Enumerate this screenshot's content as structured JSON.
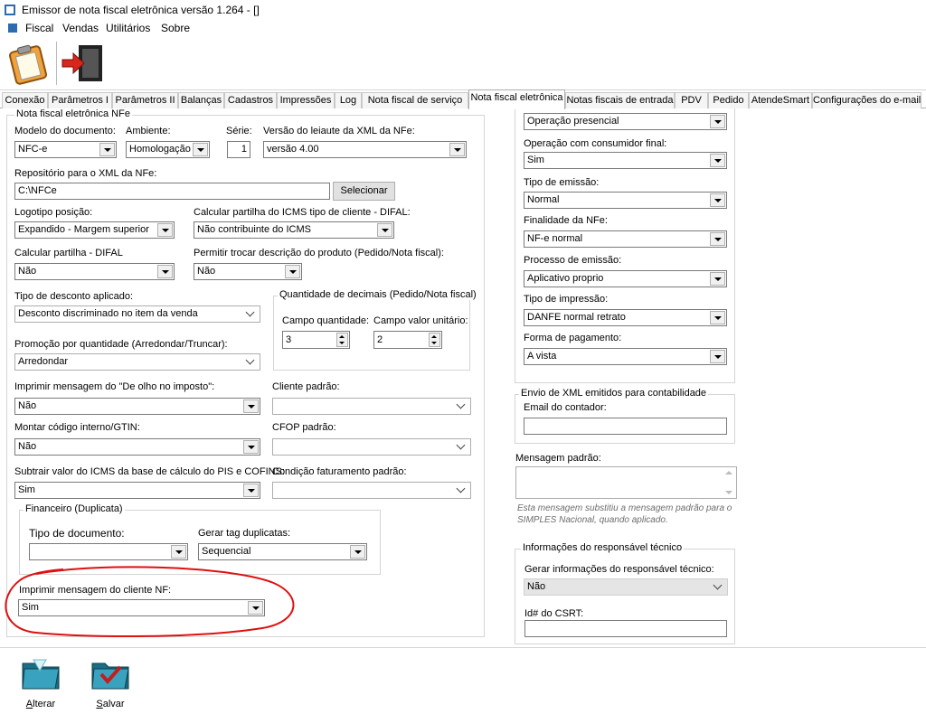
{
  "window": {
    "title": "Emissor de nota fiscal eletrônica versão 1.264 - []"
  },
  "menu": [
    "Fiscal",
    "Vendas",
    "Utilitários",
    "Sobre"
  ],
  "tabs": [
    "Conexão",
    "Parâmetros I",
    "Parâmetros II",
    "Balanças",
    "Cadastros",
    "Impressões",
    "Log",
    "Nota fiscal de serviço",
    "Nota fiscal eletrônica",
    "Notas fiscais de entrada",
    "PDV",
    "Pedido",
    "AtendeSmart",
    "Configurações do e-mail"
  ],
  "active_tab": "Nota fiscal eletrônica",
  "nfe": {
    "legend": "Nota fiscal eletrônica NFe",
    "modelo": {
      "label": "Modelo do documento:",
      "value": "NFC-e"
    },
    "ambiente": {
      "label": "Ambiente:",
      "value": "Homologação"
    },
    "serie": {
      "label": "Série:",
      "value": "1"
    },
    "versao": {
      "label": "Versão do leiaute da XML da NFe:",
      "value": "versão 4.00"
    },
    "repositorio": {
      "label": "Repositório para o XML da NFe:",
      "value": "C:\\NFCe",
      "button": "Selecionar"
    },
    "logotipo": {
      "label": "Logotipo posição:",
      "value": "Expandido - Margem superior"
    },
    "partilha_cliente": {
      "label": "Calcular partilha do ICMS tipo de cliente - DIFAL:",
      "value": "Não contribuinte do ICMS"
    },
    "partilha_difal": {
      "label": "Calcular partilha - DIFAL",
      "value": "Não"
    },
    "trocar_descricao": {
      "label": "Permitir trocar descrição do produto (Pedido/Nota fiscal):",
      "value": "Não"
    },
    "tipo_desconto": {
      "label": "Tipo de desconto aplicado:",
      "value": "Desconto discriminado no item da venda"
    },
    "decimais": {
      "legend": "Quantidade de decimais (Pedido/Nota fiscal)",
      "qtd_label": "Campo quantidade:",
      "qtd_value": "3",
      "valor_label": "Campo valor unitário:",
      "valor_value": "2"
    },
    "promocao": {
      "label": "Promoção por quantidade (Arredondar/Truncar):",
      "value": "Arredondar"
    },
    "olho_imposto": {
      "label": "Imprimir mensagem do \"De olho no imposto\":",
      "value": "Não"
    },
    "cliente_padrao": {
      "label": "Cliente padrão:",
      "value": ""
    },
    "codigo_interno": {
      "label": "Montar código interno/GTIN:",
      "value": "Não"
    },
    "cfop": {
      "label": "CFOP padrão:",
      "value": ""
    },
    "subtrair_icms": {
      "label": "Subtrair valor do ICMS da base de cálculo do PIS e COFINS:",
      "value": "Sim"
    },
    "condicao": {
      "label": "Condição faturamento padrão:",
      "value": ""
    },
    "financeiro": {
      "legend": "Financeiro (Duplicata)",
      "tipo_label": "Tipo de documento:",
      "tipo_value": "",
      "tag_label": "Gerar tag duplicatas:",
      "tag_value": "Sequencial"
    },
    "msg_cliente": {
      "label": "Imprimir mensagem do cliente NF:",
      "value": "Sim"
    }
  },
  "right": {
    "presenca": {
      "value": "Operação presencial"
    },
    "consumidor_final": {
      "label": "Operação com consumidor final:",
      "value": "Sim"
    },
    "tipo_emissao": {
      "label": "Tipo de emissão:",
      "value": "Normal"
    },
    "finalidade": {
      "label": "Finalidade da NFe:",
      "value": "NF-e normal"
    },
    "processo": {
      "label": "Processo de emissão:",
      "value": "Aplicativo proprio"
    },
    "impressao": {
      "label": "Tipo de impressão:",
      "value": "DANFE normal retrato"
    },
    "pagamento": {
      "label": "Forma de pagamento:",
      "value": "A vista"
    },
    "envio_xml": {
      "legend": "Envio de XML emitidos para contabilidade",
      "email_label": "Email do contador:",
      "email_value": ""
    },
    "mensagem": {
      "label": "Mensagem padrão:",
      "value": "",
      "note": "Esta mensagem substitiu a mensagem padrão para o SIMPLES Nacional, quando aplicado."
    },
    "responsavel": {
      "legend": "Informações do responsável técnico",
      "gerar_label": "Gerar informações do responsável técnico:",
      "gerar_value": "Não",
      "csrt_label": "Id# do CSRT:",
      "csrt_value": ""
    }
  },
  "actions": {
    "alterar_first": "A",
    "alterar_rest": "lterar",
    "salvar_first": "S",
    "salvar_rest": "alvar"
  },
  "colors": {
    "accent": "#d11",
    "tab_border": "#adadad"
  }
}
